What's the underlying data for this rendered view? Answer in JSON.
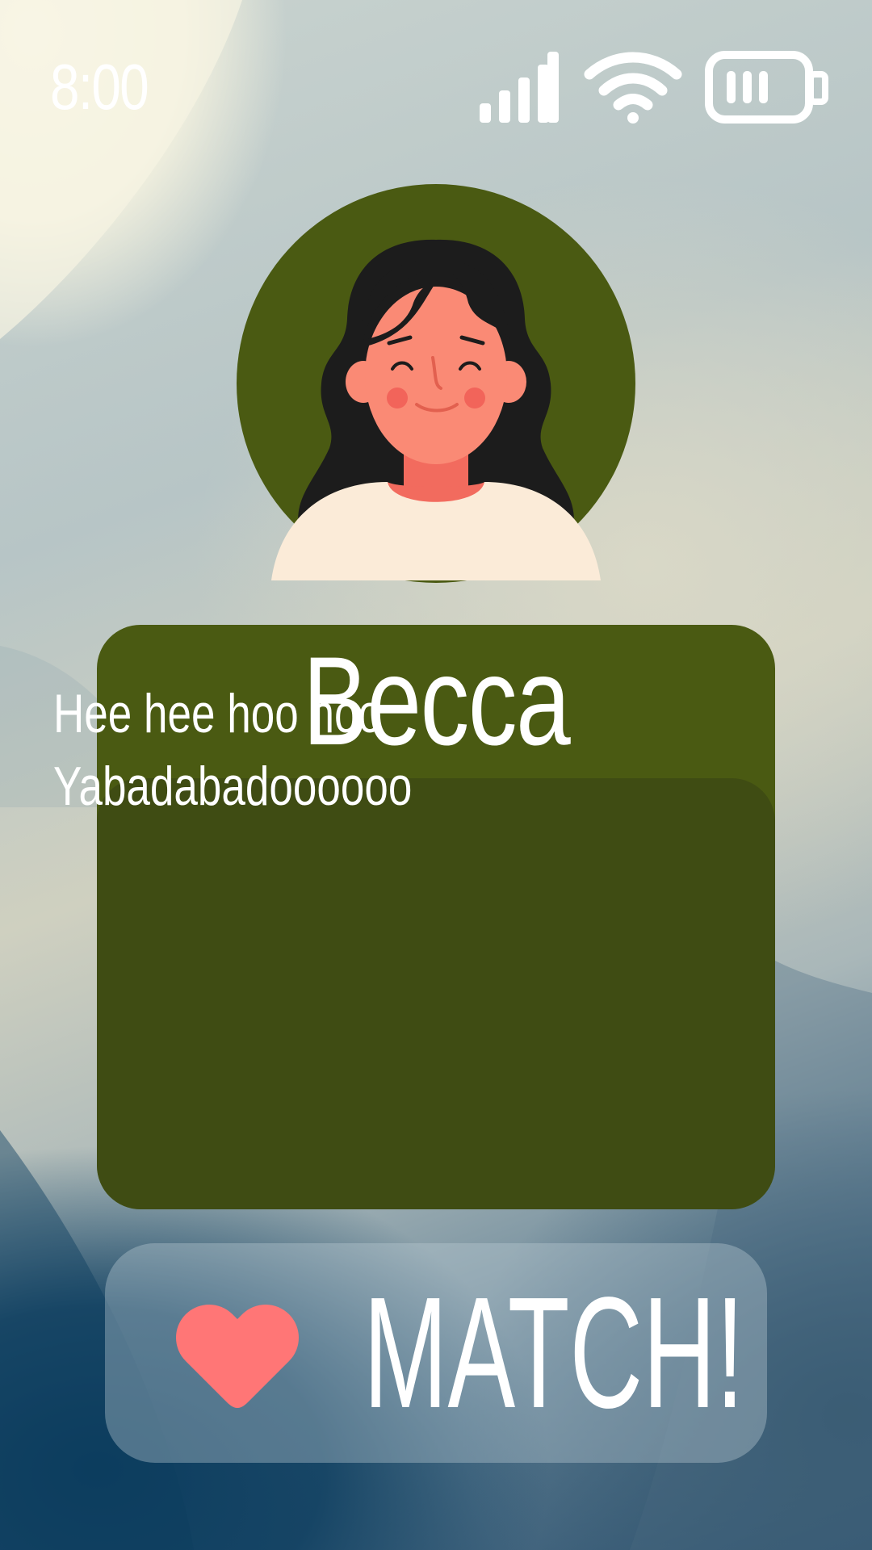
{
  "status_bar": {
    "time": "8:00",
    "icons": [
      "cellular-signal-icon",
      "wifi-icon",
      "battery-icon"
    ]
  },
  "profile": {
    "avatar": "avatar-illustration",
    "name": "Becca",
    "bio_lines": [
      "Hee hee hoo hoo",
      "Yabadabadoooooo"
    ]
  },
  "actions": {
    "match_label": "MATCH!",
    "match_icon": "heart-icon"
  },
  "colors": {
    "card": "#4a5a12",
    "bio_panel": "#3f4c13",
    "heart": "#ff7676",
    "text": "#ffffff"
  }
}
